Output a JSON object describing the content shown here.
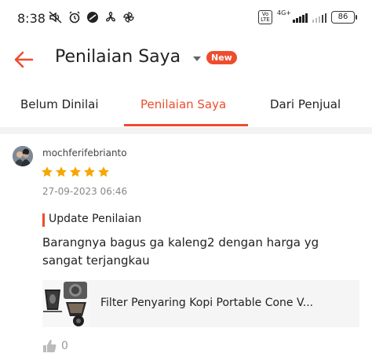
{
  "status_bar": {
    "time": "8:38",
    "network": "4G+",
    "battery": "86",
    "icons": [
      "mute-icon",
      "alarm-icon",
      "vpn-icon",
      "fan-icon",
      "pinwheel-icon",
      "volte-icon",
      "signal-icon",
      "signal-icon-2",
      "battery-icon"
    ]
  },
  "header": {
    "title": "Penilaian Saya",
    "badge": "New",
    "back_icon": "arrow-left-icon",
    "accent_color": "#ee4d2d"
  },
  "tabs": [
    {
      "label": "Belum Dinilai",
      "active": false
    },
    {
      "label": "Penilaian Saya",
      "active": true
    },
    {
      "label": "Dari Penjual",
      "active": false
    }
  ],
  "review": {
    "username": "mochferifebrianto",
    "rating": 5,
    "rating_max": 5,
    "datetime": "27-09-2023 06:46",
    "update_label": "Update Penilaian",
    "comment": "Barangnya bagus ga kaleng2 dengan harga yg sangat terjangkau",
    "product_name": "Filter Penyaring Kopi Portable Cone V...",
    "likes": "0"
  }
}
